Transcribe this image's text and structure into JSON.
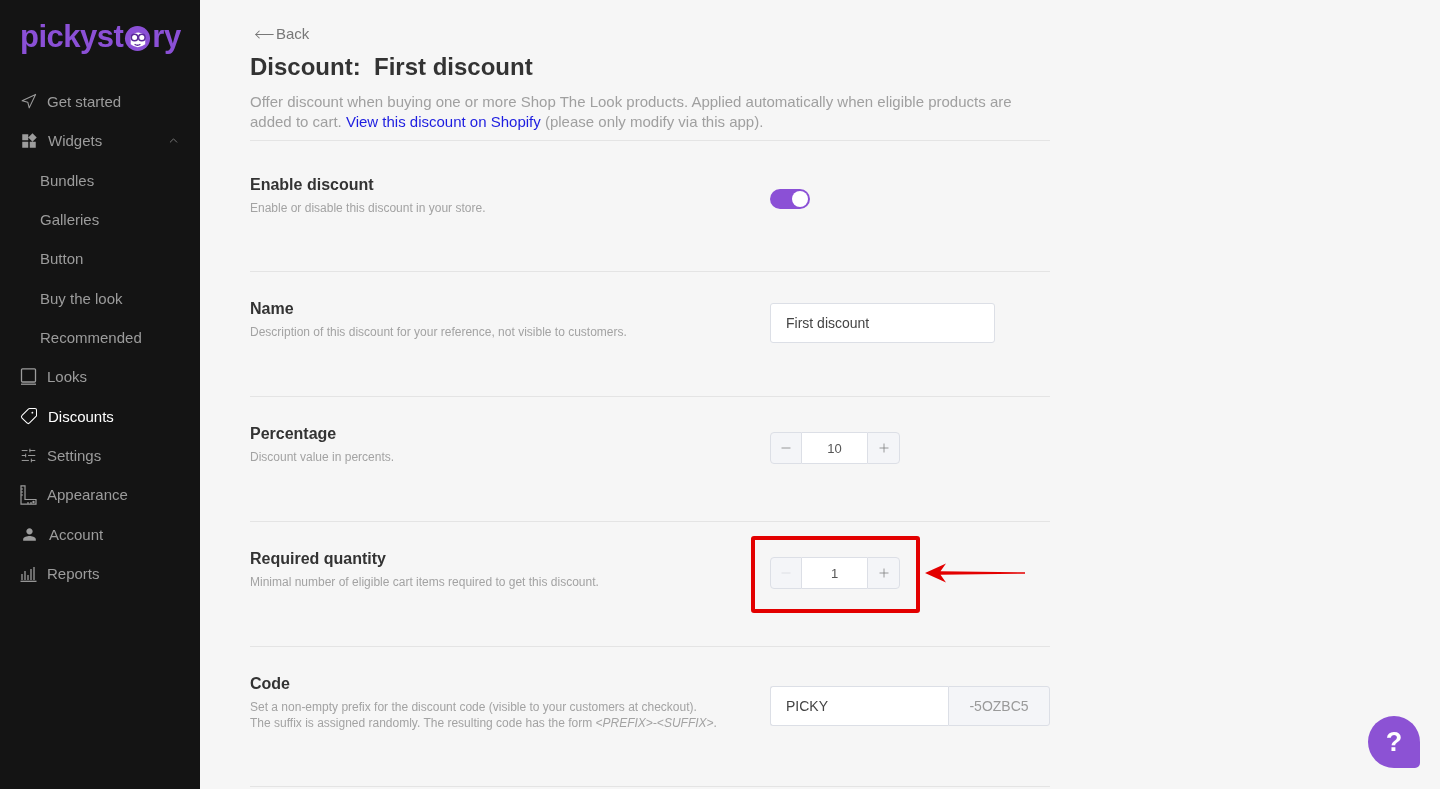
{
  "sidebar": {
    "logo": {
      "text_start": "pickyst",
      "text_end": "ry"
    },
    "items": [
      {
        "label": "Get started",
        "selected": false
      },
      {
        "label": "Widgets",
        "selected": false,
        "expanded": true,
        "children": [
          {
            "label": "Bundles",
            "selected": false
          },
          {
            "label": "Galleries",
            "selected": false
          },
          {
            "label": "Button",
            "selected": false
          },
          {
            "label": "Buy the look",
            "selected": false
          },
          {
            "label": "Recommended",
            "selected": false
          }
        ]
      },
      {
        "label": "Looks",
        "selected": false
      },
      {
        "label": "Discounts",
        "selected": true
      },
      {
        "label": "Settings",
        "selected": false
      },
      {
        "label": "Appearance",
        "selected": false
      },
      {
        "label": "Account",
        "selected": false
      },
      {
        "label": "Reports",
        "selected": false
      }
    ]
  },
  "back_link": {
    "label": "Back"
  },
  "page": {
    "title": "Discount:  First discount",
    "description": {
      "text": "Offer discount when buying one or more Shop The Look products. Applied automatically when eligible products are added to cart.",
      "link": "View this discount on Shopify",
      "text_after": "(please only modify via this app)."
    }
  },
  "sections": [
    {
      "kind": "toggle",
      "title": "Enable discount",
      "description": "Enable or disable this discount in your store.",
      "on": true,
      "highlighted": false
    },
    {
      "kind": "text",
      "title": "Name",
      "description": "Description of this discount for your reference, not visible to customers.",
      "value": "First discount",
      "highlighted": false
    },
    {
      "kind": "stepper",
      "title": "Percentage",
      "description": "Discount value in percents.",
      "value": "10",
      "decrement_disabled": false,
      "highlighted": false
    },
    {
      "kind": "stepper",
      "title": "Required quantity",
      "description": "Minimal number of eligible cart items required to get this discount.",
      "value": "1",
      "decrement_disabled": true,
      "highlighted": true
    },
    {
      "kind": "code",
      "title": "Code",
      "description": "Set a non-empty prefix for the discount code (visible to your customers at checkout).\nThe suffix is assigned randomly. The resulting code has the form *<PREFIX>-<SUFFIX>*.",
      "value": "PICKY",
      "suffix": "-5OZBC5",
      "highlighted": false
    }
  ],
  "help_button": {
    "label": "?"
  }
}
